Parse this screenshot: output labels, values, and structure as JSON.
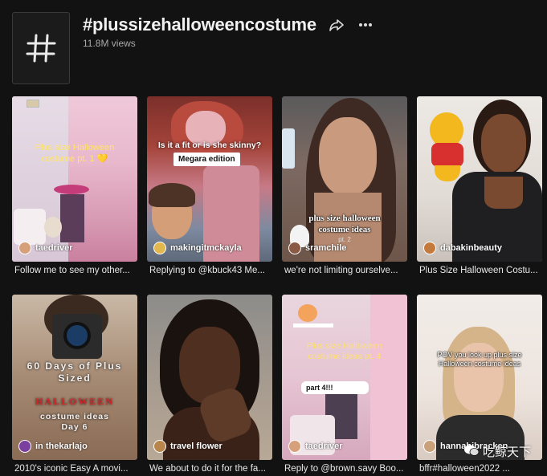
{
  "header": {
    "title": "#plussizehalloweencostume",
    "views": "11.8M views",
    "hashtag_glyph": "#"
  },
  "videos": [
    {
      "author": "taedriver",
      "caption": "Follow me to see my other...",
      "overlay": "Plus size Halloween costume pt. 1 💛",
      "avatar_color": "#d6a07b"
    },
    {
      "author": "makingitmckayla",
      "caption": "Replying to @kbuck43 Me...",
      "overlay": "Is it a fit or is she skinny?",
      "sticker": "Megara edition",
      "avatar_color": "#e0b84e"
    },
    {
      "author": "sramchile",
      "caption": "we're not limiting ourselve...",
      "overlay": "plus size halloween costume ideas",
      "overlay_sub": "pt. 2",
      "avatar_color": "#8a5a44"
    },
    {
      "author": "dabakinbeauty",
      "caption": "Plus Size Halloween Costu...",
      "avatar_color": "#c47a3c"
    },
    {
      "author": "in thekarlajo",
      "caption": "2010's iconic Easy A movi...",
      "overlay": "60 Days of Plus Sized",
      "overlay_accent": "HALLOWEEN",
      "overlay_sub": "costume ideas Day 6",
      "avatar_color": "#7b3fa0"
    },
    {
      "author": "travel flower",
      "caption": "We about to do it for the fa...",
      "avatar_color": "#b8864a"
    },
    {
      "author": "taedriver",
      "caption": "Reply to @brown.savy Boo...",
      "overlay": "Plus size Halloween costume ideas pt. 4",
      "sticker": "part 4!!!",
      "avatar_color": "#d6a07b"
    },
    {
      "author": "hannahjbracken",
      "caption": "bffr#halloween2022 ...",
      "overlay": "POV you look up plus size Halloween costume ideas",
      "avatar_color": "#c9a27c"
    }
  ],
  "watermark": "吃鲸天下",
  "icons": {
    "share": "share-arrow-icon",
    "more": "more-dots-icon",
    "wechat": "wechat-icon"
  }
}
